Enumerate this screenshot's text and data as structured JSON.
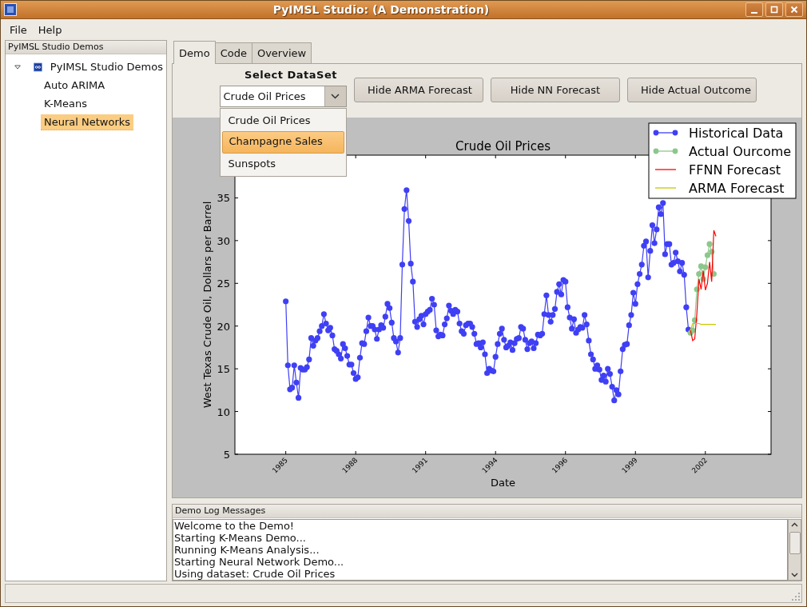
{
  "window": {
    "title": "PyIMSL Studio: (A Demonstration)"
  },
  "menu": [
    {
      "label": "File"
    },
    {
      "label": "Help"
    }
  ],
  "sidebar": {
    "title": "PyIMSL Studio Demos",
    "tree": [
      {
        "label": "PyIMSL Studio Demos",
        "expanded": true,
        "selected": false,
        "children": [
          {
            "label": "Auto ARIMA",
            "selected": false
          },
          {
            "label": "K-Means",
            "selected": false
          },
          {
            "label": "Neural Networks",
            "selected": true
          }
        ]
      }
    ]
  },
  "tabs": [
    {
      "label": "Demo",
      "selected": true
    },
    {
      "label": "Code",
      "selected": false
    },
    {
      "label": "Overview",
      "selected": false
    }
  ],
  "dataset": {
    "label": "Select DataSet",
    "value": "Crude Oil Prices",
    "expanded": true,
    "options": [
      {
        "label": "Crude Oil Prices",
        "highlighted": false
      },
      {
        "label": "Champagne Sales",
        "highlighted": true
      },
      {
        "label": "Sunspots",
        "highlighted": false
      }
    ]
  },
  "buttons": [
    {
      "label": "Hide ARMA Forecast"
    },
    {
      "label": "Hide NN Forecast"
    },
    {
      "label": "Hide Actual Outcome"
    }
  ],
  "chart_data": {
    "type": "line",
    "title": "Crude Oil Prices",
    "xlabel": "Date",
    "ylabel": "West Texas Crude Oil, Dollars per Barrel",
    "legend": "upper right",
    "categories": [
      null,
      null,
      null,
      null,
      null,
      null,
      null,
      null,
      null,
      null,
      null,
      null,
      null,
      null,
      null,
      null,
      null,
      null,
      null,
      null,
      null,
      null,
      null,
      null,
      "1985",
      null,
      null,
      null,
      null,
      null,
      null,
      null,
      null,
      null,
      null,
      null,
      null,
      null,
      null,
      null,
      null,
      null,
      null,
      null,
      null,
      null,
      null,
      null,
      null,
      null,
      null,
      null,
      null,
      null,
      null,
      null,
      null,
      "1988",
      null,
      null,
      null,
      null,
      null,
      null,
      null,
      null,
      null,
      null,
      null,
      null,
      null,
      null,
      null,
      null,
      null,
      null,
      null,
      null,
      null,
      null,
      null,
      null,
      null,
      null,
      null,
      null,
      null,
      null,
      null,
      null,
      "1991",
      null,
      null,
      null,
      null,
      null,
      null,
      null,
      null,
      null,
      null,
      null,
      null,
      null,
      null,
      null,
      null,
      null,
      null,
      null,
      null,
      null,
      null,
      null,
      null,
      null,
      null,
      null,
      null,
      null,
      null,
      null,
      null,
      "1994",
      null,
      null,
      null,
      null,
      null,
      null,
      null,
      null,
      null,
      null,
      null,
      null,
      null,
      null,
      null,
      null,
      null,
      null,
      null,
      null,
      null,
      null,
      null,
      null,
      null,
      null,
      null,
      null,
      null,
      null,
      null,
      null,
      "1996",
      null,
      null,
      null,
      null,
      null,
      null,
      null,
      null,
      null,
      null,
      null,
      null,
      null,
      null,
      null,
      null,
      null,
      null,
      null,
      null,
      null,
      null,
      null,
      null,
      null,
      null,
      null,
      null,
      null,
      null,
      null,
      null,
      "1999",
      null,
      null,
      null,
      null,
      null,
      null,
      null,
      null,
      null,
      null,
      null,
      null,
      null,
      null,
      null,
      null,
      null,
      null,
      null,
      null,
      null,
      null,
      null,
      null,
      null,
      null,
      null,
      null,
      null,
      null,
      null,
      null,
      "2002",
      null,
      null,
      null,
      null,
      null,
      null,
      null,
      null,
      null,
      null,
      null,
      null,
      null,
      null,
      null,
      null,
      null,
      null,
      null,
      null,
      null,
      null,
      null,
      null,
      null,
      null,
      null,
      null,
      null,
      null,
      null
    ],
    "series": [
      {
        "name": "Historical Data",
        "color": "#3f3ff5",
        "marker": "o",
        "values": [
          null,
          null,
          null,
          null,
          null,
          null,
          null,
          null,
          null,
          null,
          null,
          null,
          null,
          null,
          null,
          null,
          null,
          null,
          null,
          null,
          null,
          null,
          null,
          null,
          22.9,
          15.4,
          12.6,
          12.8,
          15.4,
          13.4,
          11.6,
          15.1,
          14.9,
          14.9,
          15.2,
          16.1,
          18.6,
          17.7,
          18.3,
          18.6,
          19.4,
          20.0,
          21.4,
          20.3,
          19.5,
          19.8,
          18.9,
          17.3,
          17.1,
          16.7,
          16.2,
          17.9,
          17.4,
          16.5,
          15.5,
          15.5,
          14.5,
          13.8,
          14.0,
          16.3,
          18.0,
          17.9,
          19.4,
          21.0,
          20.0,
          20.0,
          19.6,
          18.5,
          19.6,
          20.1,
          19.8,
          21.1,
          22.6,
          22.1,
          20.4,
          18.6,
          18.2,
          16.9,
          18.6,
          27.2,
          33.7,
          35.9,
          32.3,
          27.3,
          25.2,
          20.5,
          19.9,
          20.8,
          21.2,
          20.2,
          21.4,
          21.7,
          21.9,
          23.2,
          22.5,
          19.5,
          18.8,
          19.0,
          18.9,
          20.2,
          20.9,
          22.4,
          21.8,
          21.4,
          21.9,
          21.7,
          20.3,
          19.4,
          19.1,
          20.1,
          20.3,
          20.3,
          19.9,
          19.1,
          17.9,
          18.0,
          17.5,
          18.1,
          16.7,
          14.5,
          15.0,
          14.8,
          14.7,
          16.4,
          17.9,
          19.1,
          19.7,
          18.4,
          17.5,
          17.7,
          18.1,
          17.2,
          18.0,
          18.5,
          18.6,
          19.9,
          19.7,
          18.4,
          17.3,
          18.0,
          18.2,
          17.4,
          18.0,
          19.0,
          18.9,
          19.1,
          21.4,
          23.6,
          21.3,
          20.5,
          21.3,
          22.0,
          24.0,
          24.9,
          23.7,
          25.4,
          25.2,
          22.2,
          21.0,
          19.7,
          20.8,
          19.2,
          19.6,
          19.9,
          19.8,
          21.3,
          20.2,
          18.3,
          16.7,
          16.1,
          15.0,
          15.4,
          14.9,
          13.7,
          14.2,
          13.5,
          15.0,
          14.4,
          12.9,
          11.3,
          12.5,
          12.0,
          14.7,
          17.3,
          17.8,
          17.9,
          20.1,
          21.3,
          23.9,
          22.6,
          24.9,
          26.1,
          27.2,
          29.4,
          29.9,
          25.7,
          28.8,
          31.8,
          29.7,
          31.3,
          33.9,
          33.1,
          34.4,
          28.4,
          29.6,
          29.6,
          27.2,
          27.4,
          28.6,
          27.6,
          26.4,
          27.4,
          26.0,
          22.2,
          19.6,
          19.4,
          null,
          null,
          null,
          null,
          null,
          null,
          null,
          null,
          null,
          null,
          null,
          null,
          null,
          null,
          null,
          null,
          null,
          null,
          null,
          null,
          null,
          null,
          null,
          null,
          null,
          null,
          null,
          null,
          null,
          null,
          null,
          null,
          null,
          null,
          null,
          null,
          null,
          null
        ]
      },
      {
        "name": "Actual Ourcome",
        "color": "#8cc78c",
        "marker": "o",
        "values": [
          null,
          null,
          null,
          null,
          null,
          null,
          null,
          null,
          null,
          null,
          null,
          null,
          null,
          null,
          null,
          null,
          null,
          null,
          null,
          null,
          null,
          null,
          null,
          null,
          null,
          null,
          null,
          null,
          null,
          null,
          null,
          null,
          null,
          null,
          null,
          null,
          null,
          null,
          null,
          null,
          null,
          null,
          null,
          null,
          null,
          null,
          null,
          null,
          null,
          null,
          null,
          null,
          null,
          null,
          null,
          null,
          null,
          null,
          null,
          null,
          null,
          null,
          null,
          null,
          null,
          null,
          null,
          null,
          null,
          null,
          null,
          null,
          null,
          null,
          null,
          null,
          null,
          null,
          null,
          null,
          null,
          null,
          null,
          null,
          null,
          null,
          null,
          null,
          null,
          null,
          null,
          null,
          null,
          null,
          null,
          null,
          null,
          null,
          null,
          null,
          null,
          null,
          null,
          null,
          null,
          null,
          null,
          null,
          null,
          null,
          null,
          null,
          null,
          null,
          null,
          null,
          null,
          null,
          null,
          null,
          null,
          null,
          null,
          null,
          null,
          null,
          null,
          null,
          null,
          null,
          null,
          null,
          null,
          null,
          null,
          null,
          null,
          null,
          null,
          null,
          null,
          null,
          null,
          null,
          null,
          null,
          null,
          null,
          null,
          null,
          null,
          null,
          null,
          null,
          null,
          null,
          null,
          null,
          null,
          null,
          null,
          null,
          null,
          null,
          null,
          null,
          null,
          null,
          null,
          null,
          null,
          null,
          null,
          null,
          null,
          null,
          null,
          null,
          null,
          null,
          null,
          null,
          null,
          null,
          null,
          null,
          null,
          null,
          null,
          null,
          null,
          null,
          null,
          null,
          null,
          null,
          null,
          null,
          null,
          null,
          null,
          null,
          null,
          null,
          null,
          null,
          null,
          null,
          null,
          null,
          null,
          null,
          null,
          null,
          null,
          19.2,
          19.5,
          20.7,
          24.3,
          26.1,
          27.0,
          25.5,
          26.9,
          28.3,
          29.6,
          28.7,
          26.1,
          null,
          null,
          null,
          null,
          null,
          null,
          null,
          null,
          null,
          null,
          null,
          null,
          null,
          null,
          null,
          null,
          null,
          null,
          null,
          null,
          null,
          null,
          null,
          null,
          null,
          null,
          null
        ]
      },
      {
        "name": "FFNN Forecast",
        "color": "#ff0000",
        "values": [
          null,
          null,
          null,
          null,
          null,
          null,
          null,
          null,
          null,
          null,
          null,
          null,
          null,
          null,
          null,
          null,
          null,
          null,
          null,
          null,
          null,
          null,
          null,
          null,
          null,
          null,
          null,
          null,
          null,
          null,
          null,
          null,
          null,
          null,
          null,
          null,
          null,
          null,
          null,
          null,
          null,
          null,
          null,
          null,
          null,
          null,
          null,
          null,
          null,
          null,
          null,
          null,
          null,
          null,
          null,
          null,
          null,
          null,
          null,
          null,
          null,
          null,
          null,
          null,
          null,
          null,
          null,
          null,
          null,
          null,
          null,
          null,
          null,
          null,
          null,
          null,
          null,
          null,
          null,
          null,
          null,
          null,
          null,
          null,
          null,
          null,
          null,
          null,
          null,
          null,
          null,
          null,
          null,
          null,
          null,
          null,
          null,
          null,
          null,
          null,
          null,
          null,
          null,
          null,
          null,
          null,
          null,
          null,
          null,
          null,
          null,
          null,
          null,
          null,
          null,
          null,
          null,
          null,
          null,
          null,
          null,
          null,
          null,
          null,
          null,
          null,
          null,
          null,
          null,
          null,
          null,
          null,
          null,
          null,
          null,
          null,
          null,
          null,
          null,
          null,
          null,
          null,
          null,
          null,
          null,
          null,
          null,
          null,
          null,
          null,
          null,
          null,
          null,
          null,
          null,
          null,
          null,
          null,
          null,
          null,
          null,
          null,
          null,
          null,
          null,
          null,
          null,
          null,
          null,
          null,
          null,
          null,
          null,
          null,
          null,
          null,
          null,
          null,
          null,
          null,
          null,
          null,
          null,
          null,
          null,
          null,
          null,
          null,
          null,
          null,
          null,
          null,
          null,
          null,
          null,
          null,
          null,
          null,
          null,
          null,
          null,
          null,
          null,
          null,
          null,
          null,
          null,
          null,
          null,
          null,
          null,
          null,
          null,
          null,
          null,
          19.5,
          18.3,
          18.5,
          21.5,
          25.5,
          24.3,
          26.5,
          24.2,
          25.0,
          27.5,
          25.2,
          31.2,
          30.5,
          null,
          null,
          null,
          null,
          null,
          null,
          null,
          null,
          null,
          null,
          null,
          null,
          null,
          null,
          null,
          null,
          null,
          null,
          null,
          null,
          null,
          null,
          null,
          null,
          null,
          null
        ]
      },
      {
        "name": "ARMA Forecast",
        "color": "#c8c800",
        "values": [
          null,
          null,
          null,
          null,
          null,
          null,
          null,
          null,
          null,
          null,
          null,
          null,
          null,
          null,
          null,
          null,
          null,
          null,
          null,
          null,
          null,
          null,
          null,
          null,
          null,
          null,
          null,
          null,
          null,
          null,
          null,
          null,
          null,
          null,
          null,
          null,
          null,
          null,
          null,
          null,
          null,
          null,
          null,
          null,
          null,
          null,
          null,
          null,
          null,
          null,
          null,
          null,
          null,
          null,
          null,
          null,
          null,
          null,
          null,
          null,
          null,
          null,
          null,
          null,
          null,
          null,
          null,
          null,
          null,
          null,
          null,
          null,
          null,
          null,
          null,
          null,
          null,
          null,
          null,
          null,
          null,
          null,
          null,
          null,
          null,
          null,
          null,
          null,
          null,
          null,
          null,
          null,
          null,
          null,
          null,
          null,
          null,
          null,
          null,
          null,
          null,
          null,
          null,
          null,
          null,
          null,
          null,
          null,
          null,
          null,
          null,
          null,
          null,
          null,
          null,
          null,
          null,
          null,
          null,
          null,
          null,
          null,
          null,
          null,
          null,
          null,
          null,
          null,
          null,
          null,
          null,
          null,
          null,
          null,
          null,
          null,
          null,
          null,
          null,
          null,
          null,
          null,
          null,
          null,
          null,
          null,
          null,
          null,
          null,
          null,
          null,
          null,
          null,
          null,
          null,
          null,
          null,
          null,
          null,
          null,
          null,
          null,
          null,
          null,
          null,
          null,
          null,
          null,
          null,
          null,
          null,
          null,
          null,
          null,
          null,
          null,
          null,
          null,
          null,
          null,
          null,
          null,
          null,
          null,
          null,
          null,
          null,
          null,
          null,
          null,
          null,
          null,
          null,
          null,
          null,
          null,
          null,
          null,
          null,
          null,
          null,
          null,
          null,
          null,
          null,
          null,
          null,
          null,
          null,
          null,
          null,
          null,
          null,
          null,
          null,
          19.5,
          20.3,
          20.3,
          20.3,
          20.3,
          20.2,
          20.2,
          20.2,
          20.2,
          20.2,
          20.2,
          20.2,
          20.2,
          null,
          null,
          null,
          null,
          null,
          null,
          null,
          null,
          null,
          null,
          null,
          null,
          null,
          null,
          null,
          null,
          null,
          null,
          null,
          null,
          null,
          null,
          null,
          null,
          null,
          null
        ]
      }
    ],
    "ylim": [
      5,
      40
    ],
    "yticks": [
      5,
      10,
      15,
      20,
      25,
      30,
      35
    ]
  },
  "log": {
    "title": "Demo Log Messages",
    "lines": [
      "Welcome to the Demo!",
      "Starting K-Means Demo...",
      "Running K-Means Analysis...",
      "Starting Neural Network Demo...",
      "Using dataset: Crude Oil Prices"
    ]
  }
}
